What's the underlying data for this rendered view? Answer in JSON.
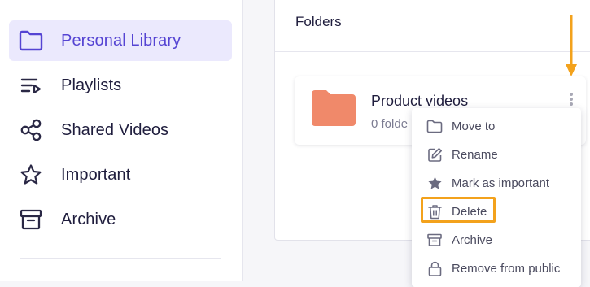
{
  "sidebar": {
    "items": [
      {
        "label": "Personal Library",
        "icon": "folder-icon",
        "active": true
      },
      {
        "label": "Playlists",
        "icon": "playlist-icon",
        "active": false
      },
      {
        "label": "Shared Videos",
        "icon": "share-icon",
        "active": false
      },
      {
        "label": "Important",
        "icon": "star-icon",
        "active": false
      },
      {
        "label": "Archive",
        "icon": "archive-icon",
        "active": false
      }
    ]
  },
  "main": {
    "section_title": "Folders",
    "folder": {
      "name": "Product videos",
      "count_text": "0 folde",
      "icon": "folder-icon",
      "color": "#f0896a"
    }
  },
  "context_menu": {
    "items": [
      {
        "label": "Move to",
        "icon": "folder-outline-icon"
      },
      {
        "label": "Rename",
        "icon": "edit-icon"
      },
      {
        "label": "Mark as important",
        "icon": "star-filled-icon"
      },
      {
        "label": "Delete",
        "icon": "trash-icon",
        "highlighted": true
      },
      {
        "label": "Archive",
        "icon": "archive-icon"
      },
      {
        "label": "Remove from public",
        "icon": "lock-icon"
      }
    ]
  },
  "colors": {
    "accent": "#5544d3",
    "active_bg": "#ebe9fd",
    "annotation": "#f3a21c",
    "folder": "#f0896a"
  }
}
